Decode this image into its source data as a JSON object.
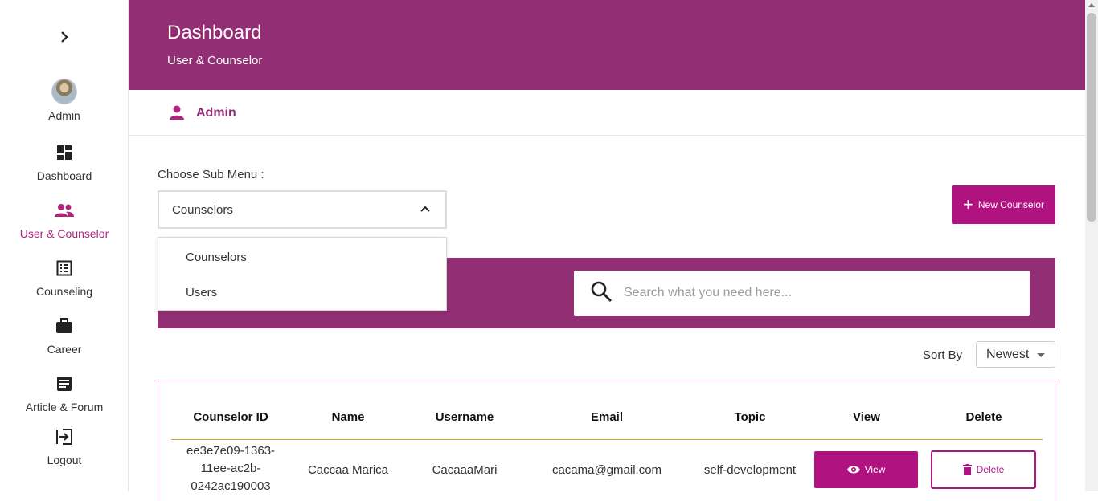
{
  "sidebar": {
    "toggle_icon": "chevron-right-icon",
    "items": [
      {
        "label": "Admin",
        "icon": "avatar"
      },
      {
        "label": "Dashboard",
        "icon": "dashboard-icon"
      },
      {
        "label": "User & Counselor",
        "icon": "people-icon"
      },
      {
        "label": "Counseling",
        "icon": "list-icon"
      },
      {
        "label": "Career",
        "icon": "briefcase-icon"
      },
      {
        "label": "Article & Forum",
        "icon": "article-icon"
      },
      {
        "label": "Logout",
        "icon": "logout-icon"
      }
    ],
    "active_color": "#b0237f"
  },
  "header": {
    "title": "Dashboard",
    "subtitle": "User & Counselor",
    "bg": "#922f74"
  },
  "admin_bar": {
    "name": "Admin"
  },
  "sub_menu": {
    "label": "Choose Sub Menu :",
    "selected": "Counselors",
    "options": [
      "Counselors",
      "Users"
    ]
  },
  "new_button": {
    "label": "New Counselor"
  },
  "search": {
    "placeholder": "Search what you need here..."
  },
  "sort": {
    "label": "Sort By",
    "value": "Newest"
  },
  "table": {
    "headers": [
      "Counselor ID",
      "Name",
      "Username",
      "Email",
      "Topic",
      "View",
      "Delete"
    ],
    "rows": [
      {
        "id_lines": [
          "ee3e7e09-1363-",
          "11ee-ac2b-",
          "0242ac190003"
        ],
        "name": "Caccaa Marica",
        "username": "CacaaaMari",
        "email": "cacama@gmail.com",
        "topic": "self-development",
        "view_label": "View",
        "delete_label": "Delete"
      }
    ]
  },
  "accent": "#b0137f"
}
